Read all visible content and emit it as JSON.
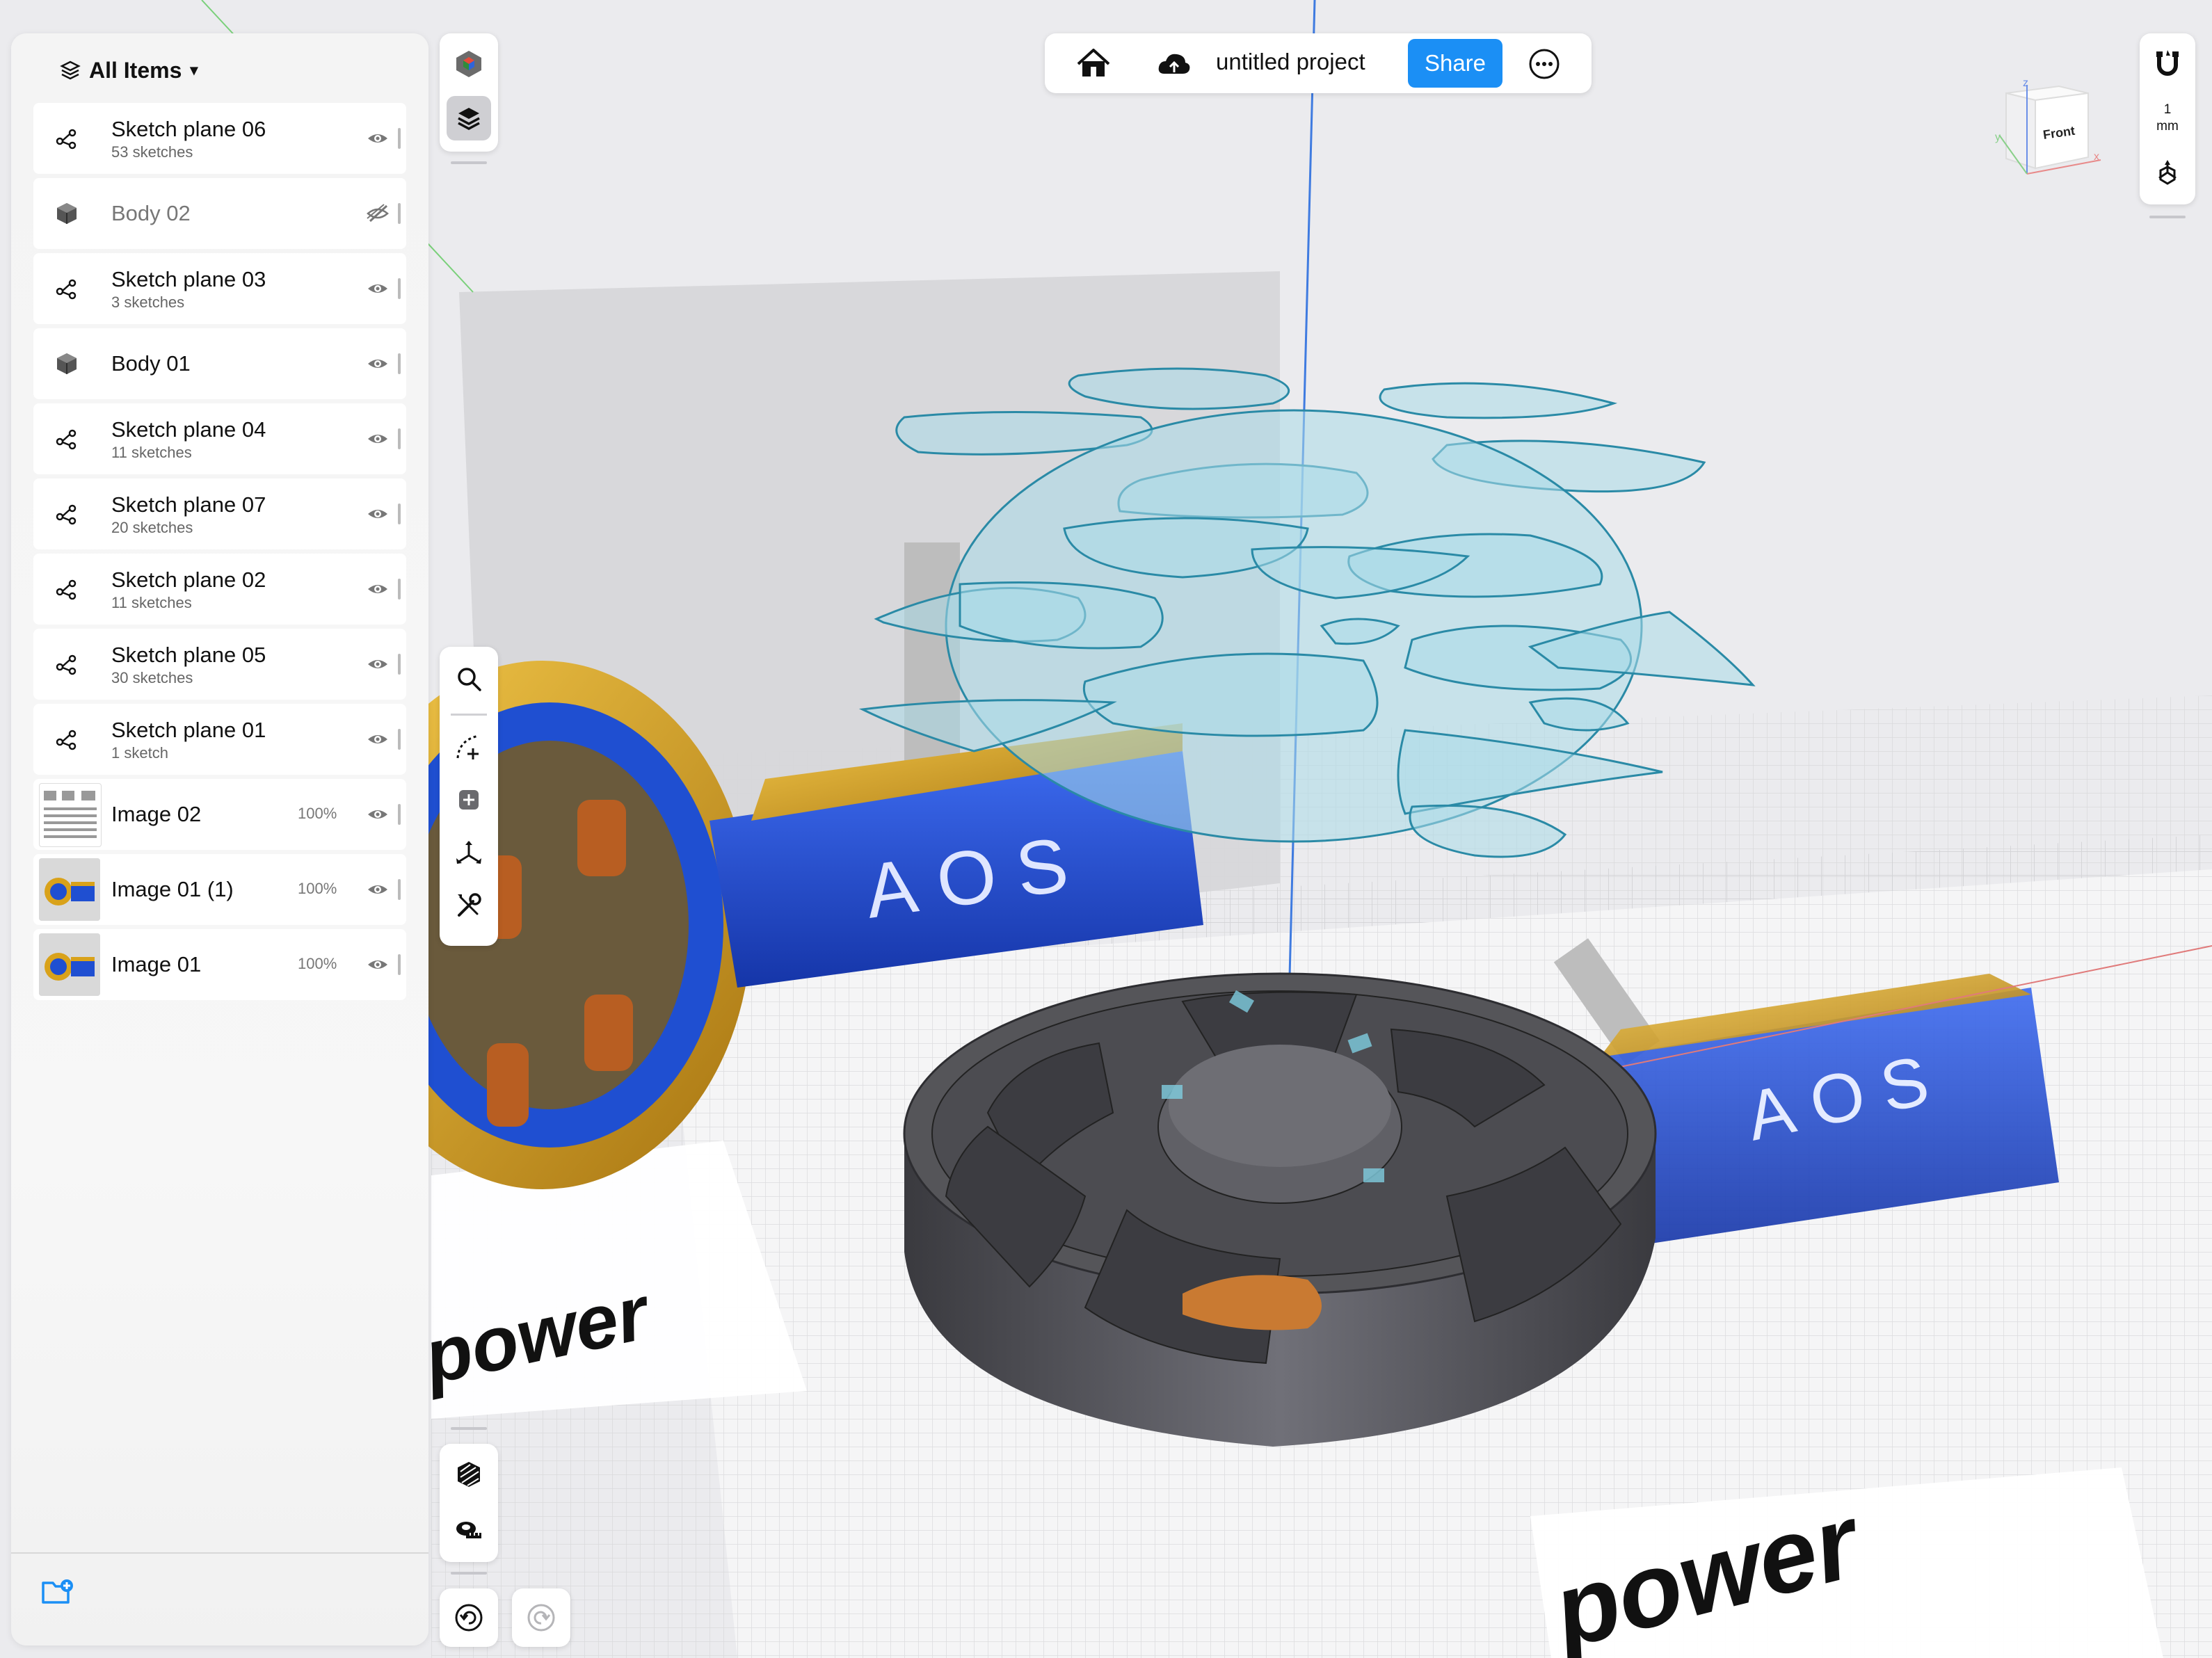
{
  "panel": {
    "header_label": "All Items",
    "items": [
      {
        "type": "sketch-plane",
        "title": "Sketch plane 06",
        "subtitle": "53 sketches",
        "percent": "",
        "visible": true
      },
      {
        "type": "body",
        "title": "Body 02",
        "subtitle": "",
        "percent": "",
        "visible": false
      },
      {
        "type": "sketch-plane",
        "title": "Sketch plane 03",
        "subtitle": "3 sketches",
        "percent": "",
        "visible": true
      },
      {
        "type": "body",
        "title": "Body 01",
        "subtitle": "",
        "percent": "",
        "visible": true
      },
      {
        "type": "sketch-plane",
        "title": "Sketch plane 04",
        "subtitle": "11 sketches",
        "percent": "",
        "visible": true
      },
      {
        "type": "sketch-plane",
        "title": "Sketch plane 07",
        "subtitle": "20 sketches",
        "percent": "",
        "visible": true
      },
      {
        "type": "sketch-plane",
        "title": "Sketch plane 02",
        "subtitle": "11 sketches",
        "percent": "",
        "visible": true
      },
      {
        "type": "sketch-plane",
        "title": "Sketch plane 05",
        "subtitle": "30 sketches",
        "percent": "",
        "visible": true
      },
      {
        "type": "sketch-plane",
        "title": "Sketch plane 01",
        "subtitle": "1 sketch",
        "percent": "",
        "visible": true
      },
      {
        "type": "image",
        "title": "Image 02",
        "subtitle": "",
        "percent": "100%",
        "visible": true
      },
      {
        "type": "image",
        "title": "Image 01 (1)",
        "subtitle": "",
        "percent": "100%",
        "visible": true
      },
      {
        "type": "image",
        "title": "Image 01",
        "subtitle": "",
        "percent": "100%",
        "visible": true
      }
    ]
  },
  "topbar": {
    "project_title": "untitled project",
    "share_label": "Share"
  },
  "right_strip": {
    "units_value": "1",
    "units_label": "mm"
  },
  "view_cube": {
    "face_label": "Front",
    "axis_x": "x",
    "axis_y": "y",
    "axis_z": "z"
  },
  "viewport": {
    "reference_text_1": "AOS",
    "reference_text_2": "AOS",
    "reference_text_3": "power",
    "reference_text_4": "power"
  },
  "colors": {
    "accent": "#1b8ff5",
    "sketch_fill": "#a9dbe8",
    "sketch_stroke": "#2a8aa6",
    "body": "#4a4a4e",
    "motor_blue": "#1f4fd1",
    "motor_gold": "#d9a21a"
  }
}
